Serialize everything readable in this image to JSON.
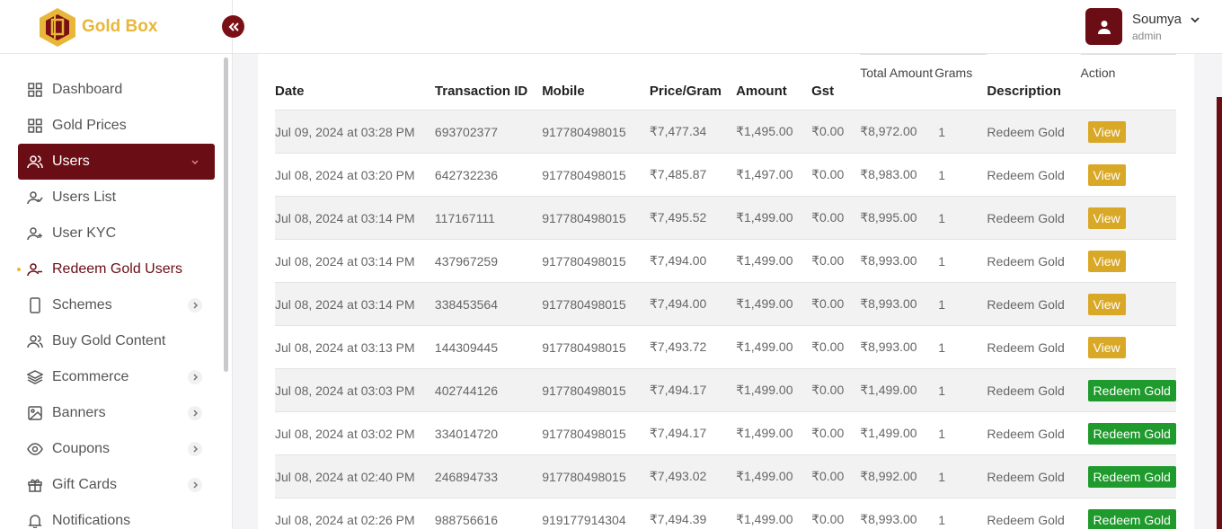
{
  "brand": {
    "name": "Gold Box"
  },
  "user": {
    "name": "Soumya",
    "role": "admin"
  },
  "sidebar": {
    "items": [
      {
        "label": "Dashboard",
        "icon": "grid-icon"
      },
      {
        "label": "Gold Prices",
        "icon": "grid-icon"
      },
      {
        "label": "Users",
        "icon": "users-icon"
      },
      {
        "label": "Users List",
        "icon": "user-check-icon"
      },
      {
        "label": "User KYC",
        "icon": "user-plus-icon"
      },
      {
        "label": "Redeem Gold Users",
        "icon": "user-minus-icon"
      },
      {
        "label": "Schemes",
        "icon": "phone-icon"
      },
      {
        "label": "Buy Gold Content",
        "icon": "users-icon"
      },
      {
        "label": "Ecommerce",
        "icon": "layers-icon"
      },
      {
        "label": "Banners",
        "icon": "image-icon"
      },
      {
        "label": "Coupons",
        "icon": "eye-icon"
      },
      {
        "label": "Gift Cards",
        "icon": "gift-icon"
      },
      {
        "label": "Notifications",
        "icon": "bell-icon"
      }
    ]
  },
  "table": {
    "headers": {
      "date": "Date",
      "txn": "Transaction ID",
      "mobile": "Mobile",
      "price": "Price/Gram",
      "amount": "Amount",
      "gst": "Gst",
      "total": "Total Amount",
      "grams": "Grams",
      "desc": "Description",
      "action": "Action"
    },
    "rows": [
      {
        "date": "Jul 09, 2024 at 03:28 PM",
        "txn": "693702377",
        "mobile": "917780498015",
        "price": "₹7,477.34",
        "amount": "₹1,495.00",
        "gst": "₹0.00",
        "total": "₹8,972.00",
        "grams": "1",
        "desc": "Redeem Gold",
        "action": "View"
      },
      {
        "date": "Jul 08, 2024 at 03:20 PM",
        "txn": "642732236",
        "mobile": "917780498015",
        "price": "₹7,485.87",
        "amount": "₹1,497.00",
        "gst": "₹0.00",
        "total": "₹8,983.00",
        "grams": "1",
        "desc": "Redeem Gold",
        "action": "View"
      },
      {
        "date": "Jul 08, 2024 at 03:14 PM",
        "txn": "117167111",
        "mobile": "917780498015",
        "price": "₹7,495.52",
        "amount": "₹1,499.00",
        "gst": "₹0.00",
        "total": "₹8,995.00",
        "grams": "1",
        "desc": "Redeem Gold",
        "action": "View"
      },
      {
        "date": "Jul 08, 2024 at 03:14 PM",
        "txn": "437967259",
        "mobile": "917780498015",
        "price": "₹7,494.00",
        "amount": "₹1,499.00",
        "gst": "₹0.00",
        "total": "₹8,993.00",
        "grams": "1",
        "desc": "Redeem Gold",
        "action": "View"
      },
      {
        "date": "Jul 08, 2024 at 03:14 PM",
        "txn": "338453564",
        "mobile": "917780498015",
        "price": "₹7,494.00",
        "amount": "₹1,499.00",
        "gst": "₹0.00",
        "total": "₹8,993.00",
        "grams": "1",
        "desc": "Redeem Gold",
        "action": "View"
      },
      {
        "date": "Jul 08, 2024 at 03:13 PM",
        "txn": "144309445",
        "mobile": "917780498015",
        "price": "₹7,493.72",
        "amount": "₹1,499.00",
        "gst": "₹0.00",
        "total": "₹8,993.00",
        "grams": "1",
        "desc": "Redeem Gold",
        "action": "View"
      },
      {
        "date": "Jul 08, 2024 at 03:03 PM",
        "txn": "402744126",
        "mobile": "917780498015",
        "price": "₹7,494.17",
        "amount": "₹1,499.00",
        "gst": "₹0.00",
        "total": "₹1,499.00",
        "grams": "1",
        "desc": "Redeem Gold",
        "action": "Redeem Gold"
      },
      {
        "date": "Jul 08, 2024 at 03:02 PM",
        "txn": "334014720",
        "mobile": "917780498015",
        "price": "₹7,494.17",
        "amount": "₹1,499.00",
        "gst": "₹0.00",
        "total": "₹1,499.00",
        "grams": "1",
        "desc": "Redeem Gold",
        "action": "Redeem Gold"
      },
      {
        "date": "Jul 08, 2024 at 02:40 PM",
        "txn": "246894733",
        "mobile": "917780498015",
        "price": "₹7,493.02",
        "amount": "₹1,499.00",
        "gst": "₹0.00",
        "total": "₹8,992.00",
        "grams": "1",
        "desc": "Redeem Gold",
        "action": "Redeem Gold"
      },
      {
        "date": "Jul 08, 2024 at 02:26 PM",
        "txn": "988756616",
        "mobile": "919177914304",
        "price": "₹7,494.39",
        "amount": "₹1,499.00",
        "gst": "₹0.00",
        "total": "₹8,993.00",
        "grams": "1",
        "desc": "Redeem Gold",
        "action": "Redeem Gold"
      }
    ]
  },
  "colors": {
    "brand": "#6b0d14",
    "gold": "#d9a826",
    "green": "#1f9a2c"
  }
}
